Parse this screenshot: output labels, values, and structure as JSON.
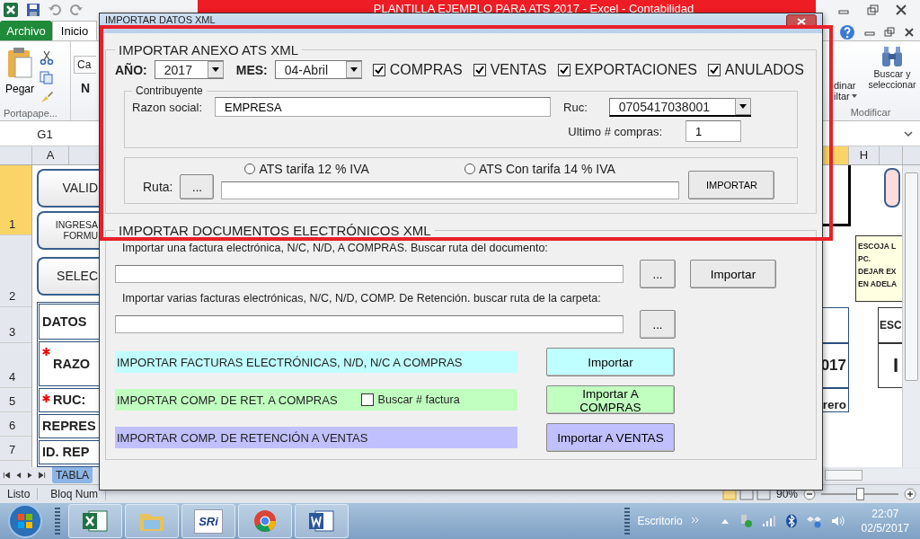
{
  "excel": {
    "title": "PLANTILLA EJEMPLO PARA ATS 2017  -  Excel - Contabilidad",
    "tabs": [
      {
        "label": "Archivo",
        "kind": "file",
        "selected": false
      },
      {
        "label": "Inicio",
        "kind": "tab",
        "selected": true
      }
    ],
    "ribbon": {
      "paste": "Pegar",
      "clipboard_group": "Portapape...",
      "font_box": "Ca",
      "bold_button": "N",
      "sort_1": "dinar",
      "sort_2": "iltar",
      "find": "Buscar y seleccionar",
      "edit_group": "Modificar"
    },
    "name_box": "G1",
    "columns": [
      {
        "label": "A",
        "selected": false
      },
      {
        "selected": true
      },
      {
        "label": "H",
        "selected": false
      }
    ],
    "rows": [
      {
        "label": "1",
        "selected": true
      },
      {
        "label": "2",
        "selected": false
      },
      {
        "label": "3",
        "selected": false
      },
      {
        "label": "4",
        "selected": false
      },
      {
        "label": "5",
        "selected": false
      },
      {
        "label": "6",
        "selected": false
      },
      {
        "label": "7",
        "selected": false
      }
    ],
    "sheet_buttons": [
      {
        "lines": [
          "VALID"
        ]
      },
      {
        "lines": [
          "INGRESA",
          "FORMU"
        ]
      },
      {
        "lines": [
          "SELEC"
        ]
      }
    ],
    "left_cells": [
      {
        "text": "DATOS",
        "required": false
      },
      {
        "text": "RAZO",
        "required": true
      },
      {
        "text": "RUC:",
        "required": true
      },
      {
        "text": "REPRES",
        "required": false
      },
      {
        "text": "ID. REP",
        "required": false
      }
    ],
    "right_cells": [
      "017",
      "rero"
    ],
    "note": [
      "ESCOJA L",
      "PC.",
      "DEJAR EX",
      "EN ADELA"
    ],
    "right_table": [
      "ESC",
      "I"
    ],
    "sheet_tab": "TABLA",
    "status": {
      "ready": "Listo",
      "numlock": "Bloq Num",
      "zoom": "90%",
      "zoom_slider": {
        "level": 0.5
      }
    }
  },
  "dialog": {
    "title": "IMPORTAR DATOS XML",
    "ats": {
      "legend": "IMPORTAR ANEXO ATS  XML",
      "year_label": "AÑO:",
      "year": "2017",
      "month_label": "MES:",
      "month": "04-Abril",
      "options": [
        {
          "label": "COMPRAS",
          "checked": true
        },
        {
          "label": "VENTAS",
          "checked": true
        },
        {
          "label": "EXPORTACIONES",
          "checked": true
        },
        {
          "label": "ANULADOS",
          "checked": true
        }
      ],
      "taxpayer": {
        "legend": "Contribuyente",
        "name_label": "Razon social:",
        "name": "EMPRESA",
        "ruc_label": "Ruc:",
        "ruc": "0705417038001",
        "last_label": "Ultimo # compras:",
        "last": "1"
      },
      "rates": [
        {
          "label": "ATS tarifa 12 % IVA",
          "selected": false
        },
        {
          "label": "ATS Con tarifa 14 % IVA",
          "selected": false
        }
      ],
      "path_label": "Ruta:",
      "browse": "...",
      "import": "IMPORTAR"
    },
    "docs": {
      "legend": "IMPORTAR DOCUMENTOS ELECTRÓNICOS XML",
      "single_label": "Importar una factura electrónica, N/C, N/D, A COMPRAS. Buscar ruta del documento:",
      "single_browse": "...",
      "single_import": "Importar",
      "multi_label": "Importar varias facturas electrónicas, N/C, N/D, COMP. De Retención. buscar ruta de la carpeta:",
      "multi_browse": "...",
      "actions": [
        {
          "label": "IMPORTAR FACTURAS ELECTRÓNICAS, N/D, N/C A COMPRAS",
          "button": "Importar",
          "color": "#c0ffff"
        },
        {
          "label": "IMPORTAR COMP. DE RET. A COMPRAS",
          "button": "Importar A COMPRAS",
          "color": "#c0ffc0",
          "option": {
            "label": "Buscar # factura",
            "checked": false
          }
        },
        {
          "label": "IMPORTAR COMP. DE RETENCIÓN  A  VENTAS",
          "button": "Importar A VENTAS",
          "color": "#c0c0ff"
        }
      ]
    }
  },
  "taskbar": {
    "apps": [
      {
        "kind": "excel"
      },
      {
        "kind": "folder"
      },
      {
        "kind": "sri",
        "text": "SRi"
      },
      {
        "kind": "chrome"
      },
      {
        "kind": "word"
      }
    ],
    "desktop": "Escritorio",
    "time": "22:07",
    "date": "02/5/2017"
  }
}
